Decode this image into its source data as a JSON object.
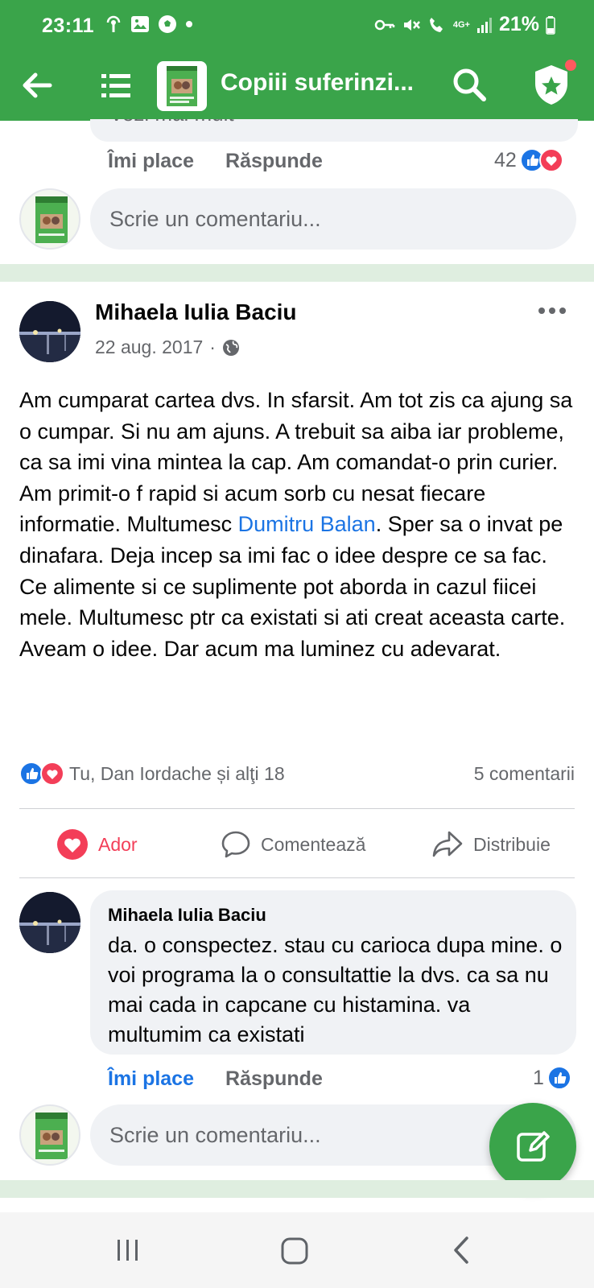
{
  "status_bar": {
    "time": "23:11",
    "network": "4G+",
    "battery": "21%",
    "left_icons": [
      "hotspot-icon",
      "gallery-icon",
      "soccer-ball-icon",
      "dot-icon"
    ],
    "right_icons": [
      "key-icon",
      "mute-icon",
      "wifi-calling-icon",
      "signal-icon",
      "battery-icon"
    ]
  },
  "app_bar": {
    "title": "Copiii suferinzi...",
    "accent": "#3aa44a"
  },
  "previous_comment": {
    "truncated_text": "Vezi mai mult",
    "like_label": "Îmi place",
    "reply_label": "Răspunde",
    "reaction_count": "42"
  },
  "write_comment": {
    "placeholder": "Scrie un comentariu..."
  },
  "post": {
    "author": "Mihaela Iulia Baciu",
    "date": "22 aug. 2017",
    "date_sep": "·",
    "body_part1": "Am cumparat cartea dvs. In sfarsit. Am tot zis ca ajung sa o cumpar. Si nu am ajuns. A trebuit sa aiba iar probleme, ca sa imi vina mintea la cap. Am comandat-o prin curier. Am primit-o f rapid si acum sorb cu nesat fiecare informatie. Multumesc",
    "mention": "Dumitru Balan",
    "body_part2": ". Sper sa o invat pe dinafara. Deja incep sa imi fac o idee despre ce sa fac. Ce alimente si ce suplimente pot aborda in cazul fiicei mele. Multumesc ptr ca existati si ati creat aceasta carte. Aveam o idee. Dar acum ma luminez cu adevarat.",
    "reactions_text": "Tu, Dan Iordache și alţi 18",
    "comments_count": "5 comentarii"
  },
  "actions": {
    "love": "Ador",
    "comment": "Comentează",
    "share": "Distribuie"
  },
  "reply": {
    "author": "Mihaela Iulia Baciu",
    "text": "da. o conspectez. stau cu carioca dupa mine. o voi programa la o consultattie la dvs. ca sa nu mai cada in capcane cu histamina. va multumim ca existati",
    "like_label": "Îmi place",
    "reply_label": "Răspunde",
    "reaction_count": "1"
  },
  "colors": {
    "like_blue": "#1b74e4",
    "love_red": "#f33e58",
    "secondary_text": "#65676b"
  }
}
